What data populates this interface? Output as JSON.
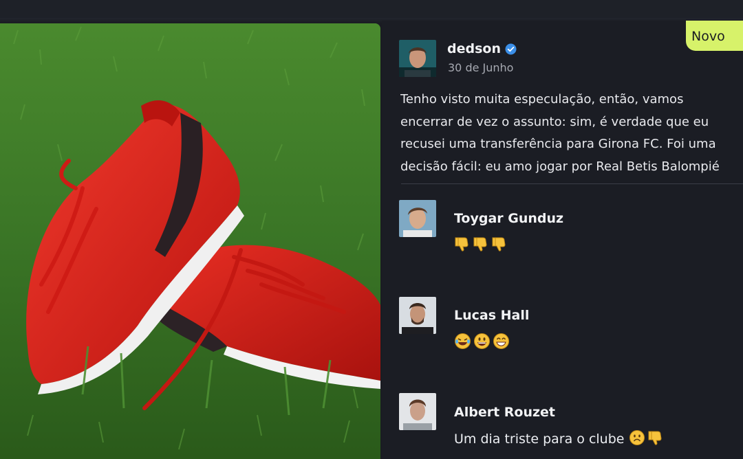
{
  "badge": {
    "label": "Novo"
  },
  "post": {
    "author": "dedson",
    "verified_icon": "verified-check-icon",
    "date": "30 de Junho",
    "lines": [
      "Tenho visto muita especulação, então, vamos",
      "encerrar de vez o assunto: sim, é verdade que eu",
      "recusei uma transferência para Girona FC. Foi uma",
      "decisão fácil: eu amo jogar por Real Betis Balompié"
    ]
  },
  "comments": [
    {
      "name": "Toygar Gunduz",
      "text": "",
      "emojis": [
        "thumbs-down-icon",
        "thumbs-down-icon",
        "thumbs-down-icon"
      ]
    },
    {
      "name": "Lucas Hall",
      "text": "",
      "emojis": [
        "tears-of-joy-icon",
        "grinning-face-icon",
        "beaming-face-icon"
      ]
    },
    {
      "name": "Albert Rouzet",
      "text": "Um dia triste para o clube",
      "emojis": [
        "frowning-face-icon",
        "thumbs-down-icon"
      ]
    }
  ],
  "colors": {
    "accent": "#d7f26a",
    "panel": "#1b1d24",
    "boot": "#e0261f",
    "grass": "#3d7a25"
  }
}
